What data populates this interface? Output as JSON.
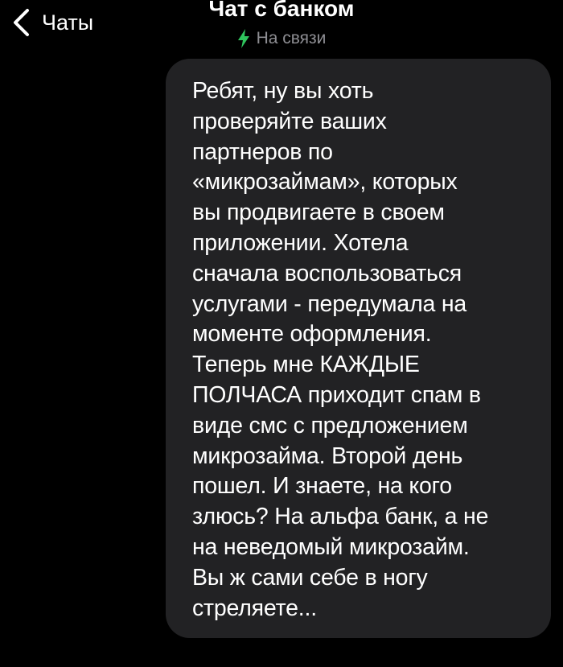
{
  "header": {
    "back_label": "Чаты",
    "title": "Чат с банком",
    "status": "На связи",
    "back_icon": "chevron-left-icon",
    "status_icon": "lightning-bolt-icon"
  },
  "colors": {
    "background": "#000000",
    "bubble": "#222224",
    "status_text": "#8e8e93",
    "status_bolt": "#2fc55d"
  },
  "messages": [
    {
      "text": "Ребят, ну вы хоть\nпроверяйте ваших\nпартнеров по\n«микрозаймам», которых\nвы продвигаете в своем\nприложении. Хотела\nсначала воспользоваться\nуслугами - передумала на\nмоменте оформления.\nТеперь мне КАЖДЫЕ\nПОЛЧАСА приходит спам в\nвиде смс с предложением\nмикрозайма. Второй день\nпошел. И знаете, на кого\nзлюсь? На альфа банк, а не\nна неведомый микрозайм.\nВы ж сами себе в ногу\nстреляете..."
    }
  ]
}
